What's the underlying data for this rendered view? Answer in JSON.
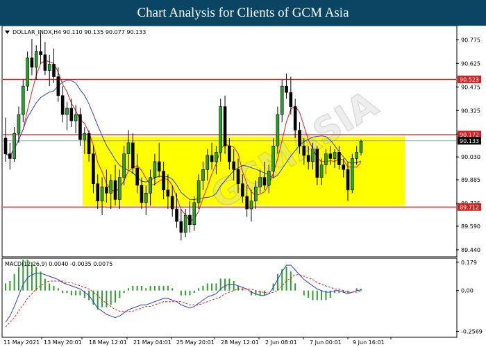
{
  "page": {
    "title": "Chart Analysis for Clients of GCM Asia"
  },
  "chart_data": [
    {
      "type": "candlestick",
      "symbol_header": "DOLLAR_INDX,H4  90.110 90.135 90.077 90.133",
      "watermark": "GCMASIA",
      "ylim": [
        89.4,
        90.86
      ],
      "y_ticks": [
        90.775,
        90.625,
        90.475,
        90.325,
        90.175,
        90.03,
        89.885,
        89.735,
        89.59,
        89.44
      ],
      "x_ticks": [
        "11 May 2021",
        "13 May 20:01",
        "18 May 12:01",
        "21 May 04:01",
        "25 May 20:01",
        "28 May 12:01",
        "2 Jun 08:01",
        "7 Jun 00:01",
        "9 Jun 16:01"
      ],
      "levels": [
        {
          "label": "90.523",
          "value": 90.523,
          "color": "#d62020"
        },
        {
          "label": "90.172",
          "value": 90.172,
          "color": "#d62020"
        },
        {
          "label": "89.712",
          "value": 89.712,
          "color": "#d62020"
        }
      ],
      "current_price": {
        "label": "90.133",
        "value": 90.133
      },
      "zone": {
        "from": 89.72,
        "to": 90.16,
        "color": "#ffff00"
      },
      "ohlc": [
        [
          90.15,
          90.28,
          90.0,
          90.05
        ],
        [
          90.05,
          90.12,
          89.95,
          90.02
        ],
        [
          90.02,
          90.22,
          90.0,
          90.18
        ],
        [
          90.18,
          90.35,
          90.12,
          90.3
        ],
        [
          90.3,
          90.52,
          90.25,
          90.48
        ],
        [
          90.48,
          90.7,
          90.45,
          90.66
        ],
        [
          90.66,
          90.78,
          90.55,
          90.6
        ],
        [
          90.6,
          90.74,
          90.52,
          90.7
        ],
        [
          90.7,
          90.82,
          90.62,
          90.68
        ],
        [
          90.68,
          90.76,
          90.55,
          90.58
        ],
        [
          90.58,
          90.68,
          90.48,
          90.62
        ],
        [
          90.62,
          90.72,
          90.5,
          90.54
        ],
        [
          90.54,
          90.6,
          90.38,
          90.42
        ],
        [
          90.42,
          90.48,
          90.25,
          90.3
        ],
        [
          90.3,
          90.38,
          90.2,
          90.34
        ],
        [
          90.34,
          90.4,
          90.22,
          90.26
        ],
        [
          90.26,
          90.36,
          90.18,
          90.3
        ],
        [
          90.3,
          90.34,
          90.1,
          90.14
        ],
        [
          90.14,
          90.22,
          90.05,
          90.18
        ],
        [
          90.18,
          90.2,
          90.0,
          90.05
        ],
        [
          90.05,
          90.1,
          89.8,
          89.86
        ],
        [
          89.86,
          89.92,
          89.7,
          89.75
        ],
        [
          89.75,
          89.9,
          89.66,
          89.84
        ],
        [
          89.84,
          89.95,
          89.74,
          89.8
        ],
        [
          89.8,
          89.92,
          89.7,
          89.88
        ],
        [
          89.88,
          89.98,
          89.72,
          89.76
        ],
        [
          89.76,
          89.95,
          89.7,
          89.9
        ],
        [
          89.9,
          90.1,
          89.85,
          90.05
        ],
        [
          90.05,
          90.2,
          89.95,
          90.12
        ],
        [
          90.12,
          90.18,
          89.92,
          89.96
        ],
        [
          89.96,
          90.05,
          89.8,
          89.85
        ],
        [
          89.85,
          89.9,
          89.7,
          89.74
        ],
        [
          89.74,
          89.85,
          89.66,
          89.8
        ],
        [
          89.8,
          89.95,
          89.72,
          89.9
        ],
        [
          89.9,
          90.05,
          89.85,
          90.0
        ],
        [
          90.0,
          90.12,
          89.9,
          89.94
        ],
        [
          89.94,
          90.0,
          89.76,
          89.82
        ],
        [
          89.82,
          89.92,
          89.7,
          89.78
        ],
        [
          89.78,
          89.85,
          89.65,
          89.7
        ],
        [
          89.7,
          89.8,
          89.58,
          89.62
        ],
        [
          89.62,
          89.7,
          89.5,
          89.55
        ],
        [
          89.55,
          89.7,
          89.52,
          89.66
        ],
        [
          89.66,
          89.75,
          89.55,
          89.6
        ],
        [
          89.6,
          89.78,
          89.56,
          89.74
        ],
        [
          89.74,
          89.92,
          89.7,
          89.88
        ],
        [
          89.88,
          90.0,
          89.82,
          89.95
        ],
        [
          89.95,
          90.08,
          89.88,
          90.04
        ],
        [
          90.04,
          90.12,
          89.95,
          90.0
        ],
        [
          90.0,
          90.1,
          89.92,
          90.06
        ],
        [
          90.06,
          90.4,
          90.0,
          90.35
        ],
        [
          90.35,
          90.42,
          90.05,
          90.1
        ],
        [
          90.1,
          90.15,
          89.95,
          90.0
        ],
        [
          90.0,
          90.08,
          89.88,
          89.95
        ],
        [
          89.95,
          90.02,
          89.8,
          89.86
        ],
        [
          89.86,
          89.92,
          89.74,
          89.78
        ],
        [
          89.78,
          89.85,
          89.65,
          89.7
        ],
        [
          89.7,
          89.82,
          89.62,
          89.75
        ],
        [
          89.75,
          89.88,
          89.7,
          89.84
        ],
        [
          89.84,
          89.95,
          89.8,
          89.9
        ],
        [
          89.9,
          90.0,
          89.82,
          89.85
        ],
        [
          89.85,
          89.98,
          89.8,
          89.94
        ],
        [
          89.94,
          90.15,
          89.9,
          90.1
        ],
        [
          90.1,
          90.35,
          90.05,
          90.3
        ],
        [
          90.3,
          90.52,
          90.25,
          90.48
        ],
        [
          90.48,
          90.56,
          90.4,
          90.44
        ],
        [
          90.44,
          90.54,
          90.3,
          90.35
        ],
        [
          90.35,
          90.4,
          90.15,
          90.2
        ],
        [
          90.2,
          90.25,
          90.05,
          90.1
        ],
        [
          90.1,
          90.15,
          89.98,
          90.04
        ],
        [
          90.04,
          90.1,
          89.95,
          90.0
        ],
        [
          90.0,
          90.12,
          89.95,
          90.08
        ],
        [
          90.08,
          90.1,
          89.85,
          89.9
        ],
        [
          89.9,
          90.02,
          89.85,
          89.98
        ],
        [
          89.98,
          90.08,
          89.92,
          90.05
        ],
        [
          90.05,
          90.1,
          89.98,
          90.02
        ],
        [
          90.02,
          90.08,
          89.96,
          90.06
        ],
        [
          90.06,
          90.1,
          89.95,
          89.98
        ],
        [
          89.98,
          90.02,
          89.9,
          89.95
        ],
        [
          89.95,
          90.0,
          89.75,
          89.82
        ],
        [
          89.82,
          90.05,
          89.8,
          90.02
        ],
        [
          90.02,
          90.1,
          89.98,
          90.06
        ],
        [
          90.06,
          90.14,
          90.04,
          90.13
        ]
      ],
      "sma_fast": {
        "color": "#d62020"
      },
      "sma_slow": {
        "color": "#2a3fd6"
      },
      "macd_panel": {
        "label": "MACD(12,26,9) 0.0040 -0.0035 0.0075",
        "ylim": [
          -0.29,
          0.2
        ],
        "y_ticks": [
          "0.179",
          "0.00",
          "-0.2569"
        ],
        "macd_line_color": "#2a3fd6",
        "signal_line_color": "#d62020",
        "histogram_color": "#2e9e2e",
        "macd": [
          -0.2,
          -0.16,
          -0.1,
          -0.03,
          0.04,
          0.08,
          0.1,
          0.11,
          0.11,
          0.1,
          0.09,
          0.08,
          0.07,
          0.05,
          0.04,
          0.03,
          0.02,
          0.01,
          -0.01,
          -0.03,
          -0.07,
          -0.11,
          -0.13,
          -0.15,
          -0.16,
          -0.17,
          -0.16,
          -0.14,
          -0.12,
          -0.11,
          -0.1,
          -0.09,
          -0.09,
          -0.08,
          -0.07,
          -0.06,
          -0.05,
          -0.05,
          -0.06,
          -0.07,
          -0.09,
          -0.1,
          -0.11,
          -0.1,
          -0.08,
          -0.06,
          -0.04,
          -0.03,
          -0.02,
          0.01,
          0.03,
          0.04,
          0.04,
          0.03,
          0.02,
          0.01,
          -0.01,
          -0.02,
          -0.03,
          -0.03,
          -0.02,
          0.02,
          0.07,
          0.12,
          0.16,
          0.16,
          0.13,
          0.1,
          0.07,
          0.05,
          0.03,
          0.01,
          0.0,
          -0.01,
          -0.01,
          0.0,
          0.0,
          -0.01,
          -0.02,
          -0.01,
          0.0,
          0.004
        ],
        "signal": [
          -0.23,
          -0.2,
          -0.17,
          -0.13,
          -0.09,
          -0.05,
          -0.02,
          0.01,
          0.03,
          0.05,
          0.06,
          0.06,
          0.06,
          0.06,
          0.05,
          0.05,
          0.04,
          0.03,
          0.02,
          0.01,
          -0.01,
          -0.03,
          -0.06,
          -0.08,
          -0.1,
          -0.12,
          -0.13,
          -0.13,
          -0.13,
          -0.13,
          -0.12,
          -0.11,
          -0.1,
          -0.1,
          -0.09,
          -0.08,
          -0.07,
          -0.07,
          -0.07,
          -0.07,
          -0.07,
          -0.08,
          -0.09,
          -0.09,
          -0.09,
          -0.08,
          -0.07,
          -0.06,
          -0.05,
          -0.04,
          -0.02,
          -0.01,
          0.0,
          0.01,
          0.01,
          0.01,
          0.01,
          0.0,
          -0.01,
          -0.01,
          -0.02,
          -0.01,
          0.0,
          0.03,
          0.06,
          0.08,
          0.1,
          0.1,
          0.09,
          0.08,
          0.07,
          0.05,
          0.04,
          0.03,
          0.02,
          0.01,
          0.01,
          0.0,
          -0.01,
          -0.01,
          -0.01,
          -0.004
        ]
      }
    }
  ]
}
